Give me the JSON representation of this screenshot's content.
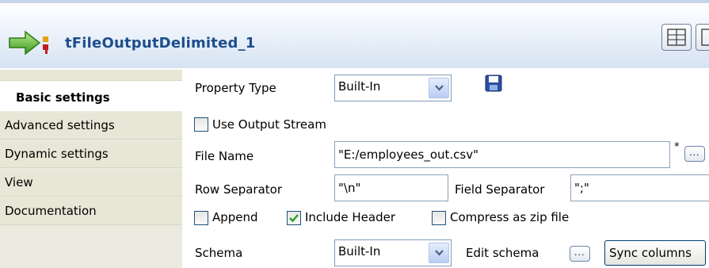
{
  "header": {
    "component_title": "tFileOutputDelimited_1"
  },
  "sidebar": {
    "items": [
      {
        "label": "Basic settings",
        "active": true
      },
      {
        "label": "Advanced settings",
        "active": false
      },
      {
        "label": "Dynamic settings",
        "active": false
      },
      {
        "label": "View",
        "active": false
      },
      {
        "label": "Documentation",
        "active": false
      }
    ]
  },
  "form": {
    "property_type_label": "Property Type",
    "property_type_value": "Built-In",
    "use_output_stream_label": "Use Output Stream",
    "use_output_stream_checked": false,
    "file_name_label": "File Name",
    "file_name_value": "\"E:/employees_out.csv\"",
    "file_name_required_mark": "*",
    "row_separator_label": "Row Separator",
    "row_separator_value": "\"\\n\"",
    "field_separator_label": "Field Separator",
    "field_separator_value": "\";\"",
    "append_label": "Append",
    "append_checked": false,
    "include_header_label": "Include Header",
    "include_header_checked": true,
    "compress_label": "Compress as zip file",
    "compress_checked": false,
    "schema_label": "Schema",
    "schema_value": "Built-In",
    "edit_schema_label": "Edit schema",
    "browse_label": "...",
    "sync_columns_label": "Sync columns"
  },
  "colors": {
    "title": "#1d4e8b",
    "header_gradient_bottom": "#d6e3f2",
    "sidebar_bg": "#e8e6d6",
    "checkbox_border": "#1c5180",
    "checkmark": "#21a121"
  },
  "icons": [
    "component-arrow-icon",
    "save-disk-icon",
    "view-toggle-icon",
    "dropdown-arrow-icon",
    "checkmark-icon"
  ]
}
